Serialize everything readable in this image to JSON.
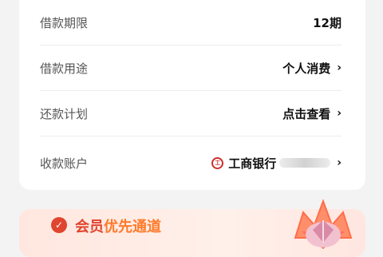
{
  "rows": [
    {
      "label": "借款期限",
      "value": "12期"
    },
    {
      "label": "借款用途",
      "value": "个人消费"
    },
    {
      "label": "还款计划",
      "value": "点击查看"
    },
    {
      "label": "收款账户",
      "value": "工商银行"
    }
  ],
  "icons": {
    "chevron": "chevron-right-icon",
    "bank": "icbc-logo-icon",
    "promo_check": "check-circle-icon",
    "promo_badge": "diamond-crown-badge-icon"
  },
  "promo": {
    "title_a": "会员",
    "title_b": "优先通道"
  },
  "colors": {
    "accent": "#e0452f",
    "bank": "#c9302c",
    "label": "#555555",
    "value": "#111111"
  }
}
